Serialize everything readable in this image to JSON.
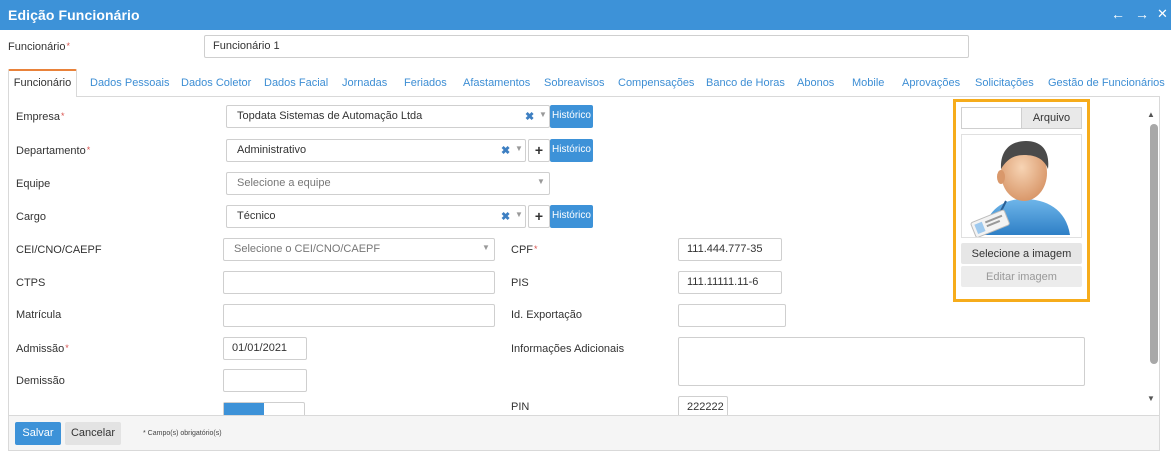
{
  "window": {
    "title": "Edição Funcionário",
    "icons": [
      "arrow-left-icon",
      "arrow-right-icon",
      "close-icon"
    ]
  },
  "funcionario": {
    "label": "Funcionário",
    "required_mark": "*",
    "value": "Funcionário 1"
  },
  "tabs": [
    {
      "label": "Funcionário",
      "active": true
    },
    {
      "label": "Dados Pessoais"
    },
    {
      "label": "Dados Coletor"
    },
    {
      "label": "Dados Facial"
    },
    {
      "label": "Jornadas"
    },
    {
      "label": "Feriados"
    },
    {
      "label": "Afastamentos"
    },
    {
      "label": "Sobreavisos"
    },
    {
      "label": "Compensações"
    },
    {
      "label": "Banco de Horas"
    },
    {
      "label": "Abonos"
    },
    {
      "label": "Mobile"
    },
    {
      "label": "Aprovações"
    },
    {
      "label": "Solicitações"
    },
    {
      "label": "Gestão de Funcionários"
    }
  ],
  "form": {
    "empresa": {
      "label": "Empresa",
      "required": "*",
      "value": "Topdata Sistemas de Automação Ltda",
      "history": "Histórico"
    },
    "departamento": {
      "label": "Departamento",
      "required": "*",
      "value": "Administrativo",
      "add": "+",
      "history": "Histórico"
    },
    "equipe": {
      "label": "Equipe",
      "placeholder": "Selecione a equipe"
    },
    "cargo": {
      "label": "Cargo",
      "value": "Técnico",
      "add": "+",
      "history": "Histórico"
    },
    "cei": {
      "label": "CEI/CNO/CAEPF",
      "placeholder": "Selecione o CEI/CNO/CAEPF"
    },
    "cpf": {
      "label": "CPF",
      "required": "*",
      "value": "111.444.777-35"
    },
    "ctps": {
      "label": "CTPS",
      "value": ""
    },
    "pis": {
      "label": "PIS",
      "value": "111.11111.11-6"
    },
    "matricula": {
      "label": "Matrícula",
      "value": ""
    },
    "id_exportacao": {
      "label": "Id. Exportação",
      "value": ""
    },
    "admissao": {
      "label": "Admissão",
      "required": "*",
      "value": "01/01/2021"
    },
    "informacoes": {
      "label": "Informações Adicionais",
      "value": ""
    },
    "demissao": {
      "label": "Demissão",
      "value": ""
    },
    "pin": {
      "label": "PIN",
      "value": "222222"
    }
  },
  "photo": {
    "file_button": "Arquivo",
    "select_image": "Selecione a imagem",
    "edit_image": "Editar imagem",
    "highlight_color": "#f6ac1b"
  },
  "footer": {
    "save": "Salvar",
    "cancel": "Cancelar",
    "required_note": "* Campo(s) obrigatório(s)"
  },
  "colors": {
    "primary": "#3d92d8",
    "active_tab_accent": "#e9823a",
    "required": "#d9534f"
  }
}
